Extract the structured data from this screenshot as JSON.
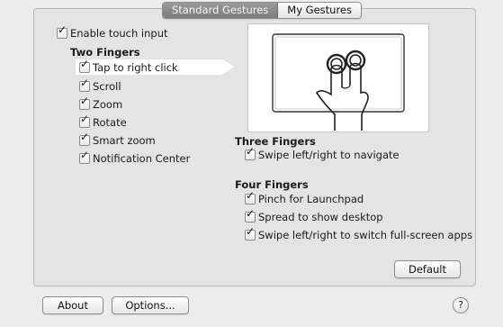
{
  "tabs": [
    {
      "label": "Standard Gestures",
      "active": true
    },
    {
      "label": "My Gestures",
      "active": false
    }
  ],
  "enable_touch": {
    "label": "Enable touch input",
    "checked": true
  },
  "two_fingers": {
    "heading": "Two Fingers",
    "items": [
      {
        "label": "Tap to right click",
        "checked": true,
        "selected": true
      },
      {
        "label": "Scroll",
        "checked": true
      },
      {
        "label": "Zoom",
        "checked": true
      },
      {
        "label": "Rotate",
        "checked": true
      },
      {
        "label": "Smart zoom",
        "checked": true
      },
      {
        "label": "Notification Center",
        "checked": true
      }
    ]
  },
  "three_fingers": {
    "heading": "Three Fingers",
    "items": [
      {
        "label": "Swipe left/right to navigate",
        "checked": true
      }
    ]
  },
  "four_fingers": {
    "heading": "Four Fingers",
    "items": [
      {
        "label": "Pinch for Launchpad",
        "checked": true
      },
      {
        "label": "Spread to show desktop",
        "checked": true
      },
      {
        "label": "Swipe left/right to switch full-screen apps",
        "checked": true
      }
    ]
  },
  "buttons": {
    "default": "Default",
    "about": "About",
    "options": "Options...",
    "help": "?"
  },
  "icons": {
    "check": "✓",
    "preview": "two-finger-tap-illustration"
  },
  "colors": {
    "background": "#ececec",
    "panel": "#e4e4e4",
    "active_tab": "#8a8a8a",
    "selection": "#ffffff"
  }
}
